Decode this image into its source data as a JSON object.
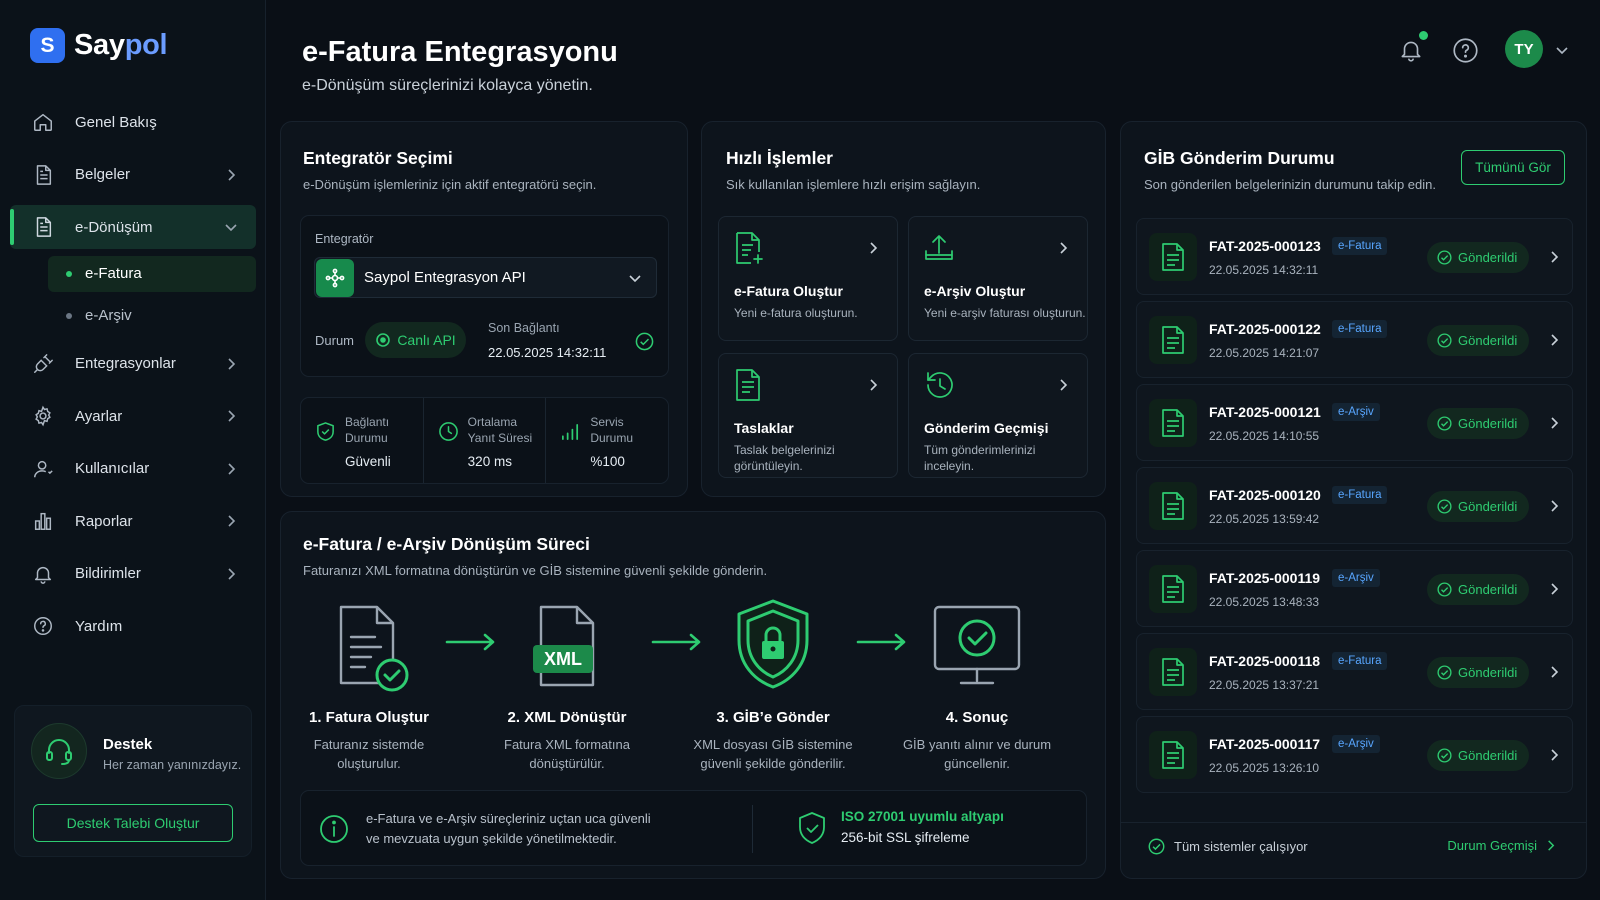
{
  "brand": {
    "logo_letter": "S",
    "name_prefix": "Say",
    "name_suffix": "pol"
  },
  "sidebar": {
    "items": [
      {
        "label": "Genel Bakış",
        "icon": "home-icon"
      },
      {
        "label": "Belgeler",
        "icon": "document-icon"
      },
      {
        "label": "e-Dönüşüm",
        "icon": "document-icon"
      },
      {
        "label": "Entegrasyonlar",
        "icon": "plug-icon"
      },
      {
        "label": "Ayarlar",
        "icon": "gear-icon"
      },
      {
        "label": "Kullanıcılar",
        "icon": "user-icon"
      },
      {
        "label": "Raporlar",
        "icon": "bar-chart-icon"
      },
      {
        "label": "Bildirimler",
        "icon": "bell-icon"
      },
      {
        "label": "Yardım",
        "icon": "help-icon"
      }
    ],
    "subitems": [
      "e-Fatura",
      "e-Arşiv"
    ],
    "support": {
      "title": "Destek",
      "subtitle": "Her zaman yanınızdayız.",
      "button": "Destek Talebi Oluştur"
    }
  },
  "header": {
    "title": "e-Fatura Entegrasyonu",
    "subtitle": "e-Dönüşüm süreçlerinizi kolayca yönetin.",
    "avatar_initials": "TY"
  },
  "integrator": {
    "title": "Entegratör Seçimi",
    "subtitle": "e-Dönüşüm işlemleriniz için aktif entegratörü seçin.",
    "field_label": "Entegratör",
    "selected": "Saypol Entegrasyon API",
    "status_label": "Durum",
    "status_value": "Canlı API",
    "last_conn_label": "Son Bağlantı",
    "last_conn_value": "22.05.2025 14:32:11",
    "stats": [
      {
        "label1": "Bağlantı",
        "label2": "Durumu",
        "value": "Güvenli"
      },
      {
        "label1": "Ortalama",
        "label2": "Yanıt Süresi",
        "value": "320 ms"
      },
      {
        "label1": "Servis",
        "label2": "Durumu",
        "value": "%100"
      }
    ]
  },
  "quick": {
    "title": "Hızlı İşlemler",
    "subtitle": "Sık kullanılan işlemlere hızlı erişim sağlayın.",
    "actions": [
      {
        "title": "e-Fatura Oluştur",
        "sub": "Yeni e-fatura oluşturun."
      },
      {
        "title": "e-Arşiv Oluştur",
        "sub": "Yeni e-arşiv faturası oluşturun."
      },
      {
        "title": "Taslaklar",
        "sub": "Taslak belgelerinizi görüntüleyin."
      },
      {
        "title": "Gönderim Geçmişi",
        "sub": "Tüm gönderimlerinizi inceleyin."
      }
    ]
  },
  "gib": {
    "title": "GİB Gönderim Durumu",
    "subtitle": "Son gönderilen belgelerinizin durumunu takip edin.",
    "view_all": "Tümünü Gör",
    "rows": [
      {
        "no": "FAT-2025-000123",
        "type": "e-Fatura",
        "date": "22.05.2025 14:32:11",
        "status": "Gönderildi"
      },
      {
        "no": "FAT-2025-000122",
        "type": "e-Fatura",
        "date": "22.05.2025 14:21:07",
        "status": "Gönderildi"
      },
      {
        "no": "FAT-2025-000121",
        "type": "e-Arşiv",
        "date": "22.05.2025 14:10:55",
        "status": "Gönderildi"
      },
      {
        "no": "FAT-2025-000120",
        "type": "e-Fatura",
        "date": "22.05.2025 13:59:42",
        "status": "Gönderildi"
      },
      {
        "no": "FAT-2025-000119",
        "type": "e-Arşiv",
        "date": "22.05.2025 13:48:33",
        "status": "Gönderildi"
      },
      {
        "no": "FAT-2025-000118",
        "type": "e-Fatura",
        "date": "22.05.2025 13:37:21",
        "status": "Gönderildi"
      },
      {
        "no": "FAT-2025-000117",
        "type": "e-Arşiv",
        "date": "22.05.2025 13:26:10",
        "status": "Gönderildi"
      }
    ],
    "footer_status": "Tüm sistemler çalışıyor",
    "footer_link": "Durum Geçmişi"
  },
  "process": {
    "title": "e-Fatura / e-Arşiv Dönüşüm Süreci",
    "subtitle": "Faturanızı XML formatına dönüştürün ve GİB sistemine güvenli şekilde gönderin.",
    "xml_badge": "XML",
    "steps": [
      {
        "title": "1. Fatura Oluştur",
        "line1": "Faturanız sistemde",
        "line2": "oluşturulur."
      },
      {
        "title": "2. XML Dönüştür",
        "line1": "Fatura XML formatına",
        "line2": "dönüştürülür."
      },
      {
        "title": "3. GİB’e Gönder",
        "line1": "XML dosyası GİB sistemine",
        "line2": "güvenli şekilde gönderilir."
      },
      {
        "title": "4. Sonuç",
        "line1": "GİB yanıtı alınır ve durum",
        "line2": "güncellenir."
      }
    ],
    "info_line1": "e-Fatura ve e-Arşiv süreçleriniz uçtan uca güvenli",
    "info_line2": "ve mevzuata uygun şekilde yönetilmektedir.",
    "iso": "ISO 27001 uyumlu altyapı",
    "ssl": "256-bit SSL şifreleme"
  },
  "colors": {
    "accent": "#2ecc71",
    "brand": "#2f6ff0",
    "background": "#0a0f16",
    "tag": "#58a6ff"
  }
}
